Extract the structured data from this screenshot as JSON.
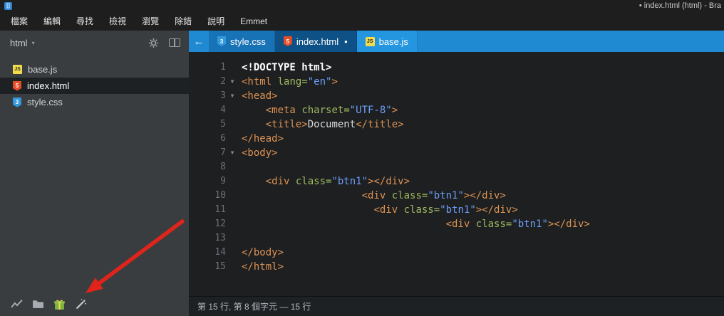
{
  "window": {
    "title": "• index.html (html) - Bra",
    "app_icon_glyph": "[]",
    "menu": [
      "檔案",
      "編輯",
      "尋找",
      "檢視",
      "瀏覽",
      "除錯",
      "說明",
      "Emmet"
    ]
  },
  "colors": {
    "tabbar": "#1f8ad2",
    "tab_inactive": "#1872b6",
    "tab_active": "#0d5187",
    "tab_light": "#2496e0",
    "editor_bg": "#1d1f21",
    "sidebar_bg": "#393d40",
    "annotation_arrow": "#e0241b"
  },
  "sidebar": {
    "project_name": "html",
    "caret": "▾",
    "files": [
      {
        "name": "base.js",
        "type": "js"
      },
      {
        "name": "index.html",
        "type": "html",
        "active": true
      },
      {
        "name": "style.css",
        "type": "css"
      }
    ]
  },
  "tabbar": {
    "back_arrow": "←",
    "tabs": [
      {
        "name": "style.css",
        "type": "css"
      },
      {
        "name": "index.html",
        "type": "html",
        "active": true,
        "dirty_mark": "•"
      },
      {
        "name": "base.js",
        "type": "js"
      }
    ]
  },
  "icons": {
    "js_glyph": "JS",
    "html_glyph": "5",
    "css_glyph": "3"
  },
  "editor": {
    "fold_marker": "▼",
    "syntax_colors": {
      "doctype": "#ffffff",
      "tag": "#de9352",
      "attribute": "#9fb95e",
      "string": "#6c9ef8",
      "text": "#dcdcdc"
    },
    "lines": [
      {
        "n": 1,
        "fold": false,
        "tokens": [
          [
            "d",
            "<!DOCTYPE html>"
          ]
        ]
      },
      {
        "n": 2,
        "fold": true,
        "tokens": [
          [
            "t",
            "<html"
          ],
          [
            "x",
            " "
          ],
          [
            "a",
            "lang="
          ],
          [
            "s",
            "\"en\""
          ],
          [
            "t",
            ">"
          ]
        ]
      },
      {
        "n": 3,
        "fold": true,
        "tokens": [
          [
            "t",
            "<head>"
          ]
        ]
      },
      {
        "n": 4,
        "fold": false,
        "tokens": [
          [
            "x",
            "    "
          ],
          [
            "t",
            "<meta"
          ],
          [
            "x",
            " "
          ],
          [
            "a",
            "charset="
          ],
          [
            "s",
            "\"UTF-8\""
          ],
          [
            "t",
            ">"
          ]
        ]
      },
      {
        "n": 5,
        "fold": false,
        "tokens": [
          [
            "x",
            "    "
          ],
          [
            "t",
            "<title>"
          ],
          [
            "x",
            "Document"
          ],
          [
            "t",
            "</title>"
          ]
        ]
      },
      {
        "n": 6,
        "fold": false,
        "tokens": [
          [
            "t",
            "</head>"
          ]
        ]
      },
      {
        "n": 7,
        "fold": true,
        "tokens": [
          [
            "t",
            "<body>"
          ]
        ]
      },
      {
        "n": 8,
        "fold": false,
        "tokens": []
      },
      {
        "n": 9,
        "fold": false,
        "tokens": [
          [
            "x",
            "    "
          ],
          [
            "t",
            "<div"
          ],
          [
            "x",
            " "
          ],
          [
            "a",
            "class="
          ],
          [
            "s",
            "\"btn1\""
          ],
          [
            "t",
            "></div>"
          ]
        ]
      },
      {
        "n": 10,
        "fold": false,
        "tokens": [
          [
            "x",
            "                    "
          ],
          [
            "t",
            "<div"
          ],
          [
            "x",
            " "
          ],
          [
            "a",
            "class="
          ],
          [
            "s",
            "\"btn1\""
          ],
          [
            "t",
            "></div>"
          ]
        ]
      },
      {
        "n": 11,
        "fold": false,
        "tokens": [
          [
            "x",
            "                      "
          ],
          [
            "t",
            "<div"
          ],
          [
            "x",
            " "
          ],
          [
            "a",
            "class="
          ],
          [
            "s",
            "\"btn1\""
          ],
          [
            "t",
            "></div>"
          ]
        ]
      },
      {
        "n": 12,
        "fold": false,
        "tokens": [
          [
            "x",
            "                                  "
          ],
          [
            "t",
            "<div"
          ],
          [
            "x",
            " "
          ],
          [
            "a",
            "class="
          ],
          [
            "s",
            "\"btn1\""
          ],
          [
            "t",
            "></div>"
          ]
        ]
      },
      {
        "n": 13,
        "fold": false,
        "tokens": []
      },
      {
        "n": 14,
        "fold": false,
        "tokens": [
          [
            "t",
            "</body>"
          ]
        ]
      },
      {
        "n": 15,
        "fold": false,
        "tokens": [
          [
            "t",
            "</html>"
          ]
        ]
      }
    ]
  },
  "statusbar": {
    "text": "第 15 行, 第 8 個字元 — 15 行"
  }
}
